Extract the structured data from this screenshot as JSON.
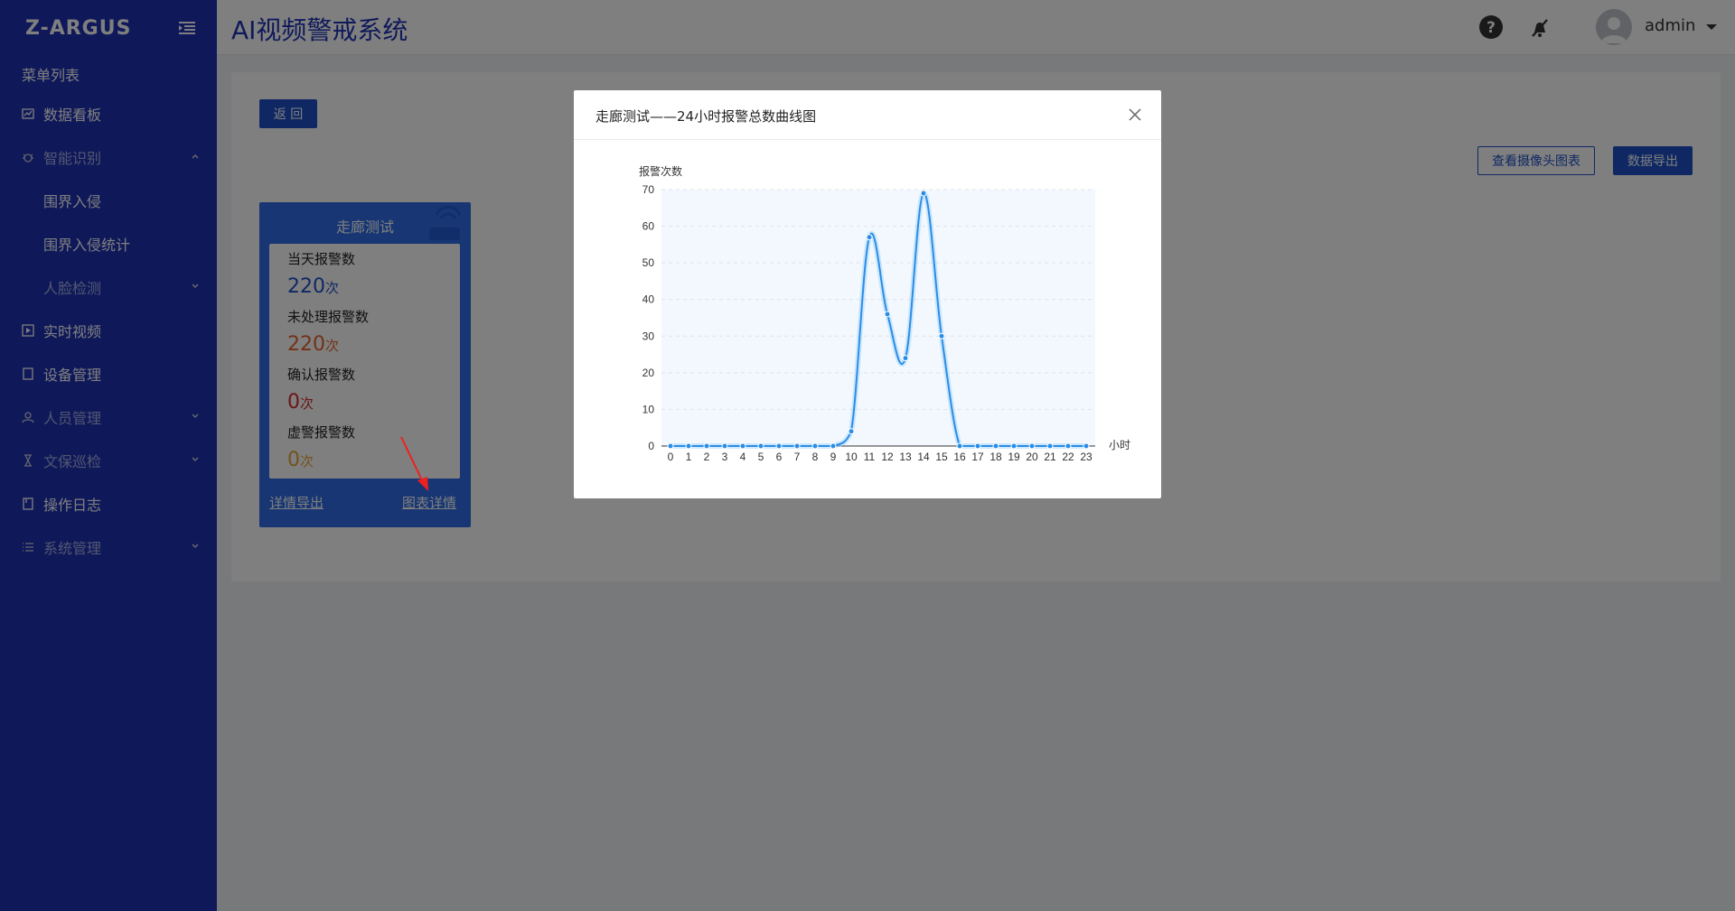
{
  "app": {
    "logo": "Z-ARGUS",
    "title": "AI视频警戒系统"
  },
  "header": {
    "username": "admin"
  },
  "sidebar": {
    "menu_title": "菜单列表",
    "items": [
      {
        "label": "数据看板"
      },
      {
        "label": "智能识别"
      },
      {
        "label": "围界入侵"
      },
      {
        "label": "围界入侵统计"
      },
      {
        "label": "人脸检测"
      },
      {
        "label": "实时视频"
      },
      {
        "label": "设备管理"
      },
      {
        "label": "人员管理"
      },
      {
        "label": "文保巡检"
      },
      {
        "label": "操作日志"
      },
      {
        "label": "系统管理"
      }
    ]
  },
  "main": {
    "back_label": "返 回",
    "view_camera_chart_label": "查看摄像头图表",
    "export_data_label": "数据导出",
    "camera_card": {
      "name": "走廊测试",
      "stats": [
        {
          "label": "当天报警数",
          "value": "220",
          "unit": "次"
        },
        {
          "label": "未处理报警数",
          "value": "220",
          "unit": "次"
        },
        {
          "label": "确认报警数",
          "value": "0",
          "unit": "次"
        },
        {
          "label": "虚警报警数",
          "value": "0",
          "unit": "次"
        }
      ],
      "detail_export_label": "详情导出",
      "chart_detail_label": "图表详情"
    }
  },
  "modal": {
    "title": "走廊测试——24小时报警总数曲线图"
  },
  "chart_data": {
    "type": "line",
    "title": "",
    "xlabel": "小时",
    "ylabel": "报警次数",
    "x": [
      0,
      1,
      2,
      3,
      4,
      5,
      6,
      7,
      8,
      9,
      10,
      11,
      12,
      13,
      14,
      15,
      16,
      17,
      18,
      19,
      20,
      21,
      22,
      23
    ],
    "series": [
      {
        "values": [
          0,
          0,
          0,
          0,
          0,
          0,
          0,
          0,
          0,
          0,
          4,
          57,
          36,
          24,
          69,
          30,
          0,
          0,
          0,
          0,
          0,
          0,
          0,
          0
        ]
      }
    ],
    "ylim": [
      0,
      70
    ],
    "yticks": [
      0,
      10,
      20,
      30,
      40,
      50,
      60,
      70
    ],
    "grid": true,
    "color": "#2a8de6"
  },
  "colors": {
    "sidebar": "#1e33b4",
    "primary": "#1e50c8",
    "card": "#2f6de6"
  }
}
